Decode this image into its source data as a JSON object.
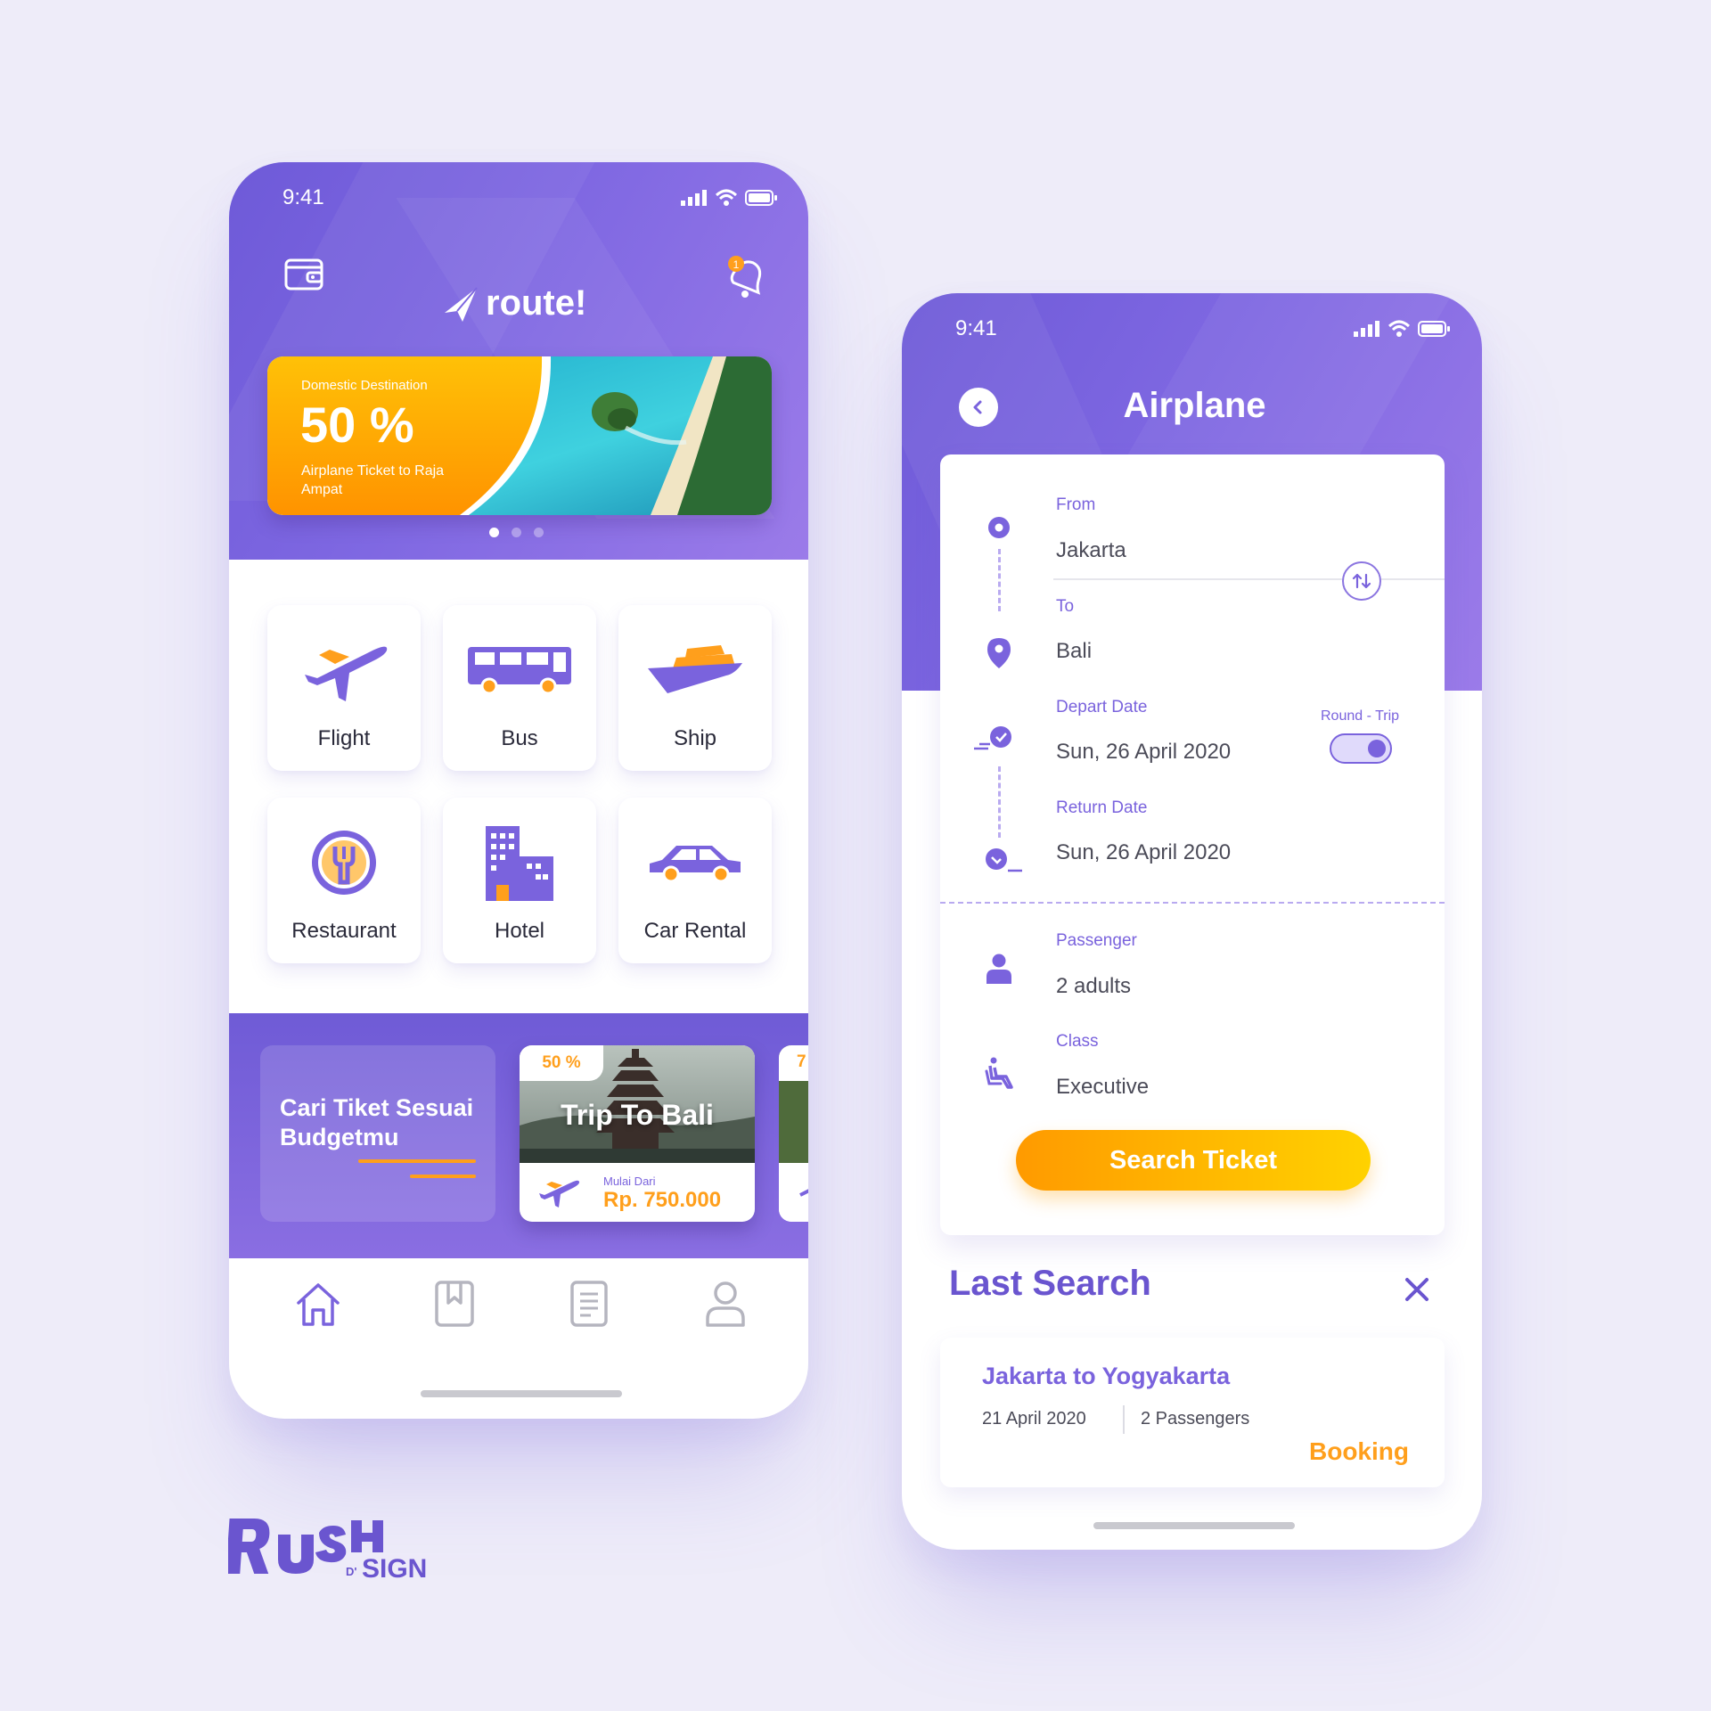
{
  "colors": {
    "background": "#eeecf9",
    "primary_purple": "#7a63dd",
    "accent_orange": "#ff9f1c",
    "accent_yellow": "#ffd200"
  },
  "home": {
    "status_time": "9:41",
    "logo_text": "route!",
    "notification_count": "1",
    "banner": {
      "subtitle": "Domestic Destination",
      "discount": "50 %",
      "description": "Airplane Ticket to Raja Ampat"
    },
    "carousel_pages": 3,
    "carousel_active": 1,
    "categories": [
      {
        "label": "Flight",
        "icon": "airplane-icon"
      },
      {
        "label": "Bus",
        "icon": "bus-icon"
      },
      {
        "label": "Ship",
        "icon": "ship-icon"
      },
      {
        "label": "Restaurant",
        "icon": "restaurant-icon"
      },
      {
        "label": "Hotel",
        "icon": "hotel-icon"
      },
      {
        "label": "Car Rental",
        "icon": "car-icon"
      }
    ],
    "promo": {
      "headline": "Cari Tiket Sesuai Budgetmu",
      "card": {
        "badge": "50 %",
        "title": "Trip To Bali",
        "price_label": "Mulai Dari",
        "price": "Rp. 750.000"
      },
      "next_badge": "7"
    },
    "nav": [
      "home-icon",
      "bookmark-icon",
      "document-icon",
      "profile-icon"
    ]
  },
  "airplane": {
    "status_time": "9:41",
    "title": "Airplane",
    "from_label": "From",
    "from_value": "Jakarta",
    "to_label": "To",
    "to_value": "Bali",
    "depart_label": "Depart Date",
    "depart_value": "Sun, 26 April 2020",
    "round_trip_label": "Round - Trip",
    "round_trip_on": true,
    "return_label": "Return Date",
    "return_value": "Sun, 26 April 2020",
    "passenger_label": "Passenger",
    "passenger_value": "2 adults",
    "class_label": "Class",
    "class_value": "Executive",
    "search_button": "Search Ticket",
    "last_search": {
      "title": "Last Search",
      "route": "Jakarta to Yogyakarta",
      "date": "21 April 2020",
      "passengers": "2 Passengers",
      "action": "Booking"
    }
  }
}
